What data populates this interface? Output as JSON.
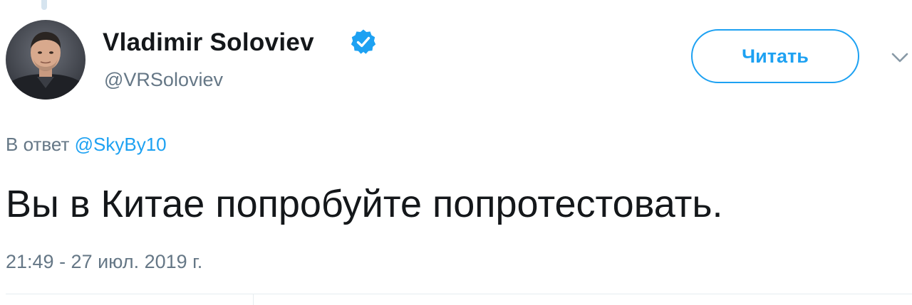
{
  "tweet": {
    "author": {
      "display_name": "Vladimir Soloviev",
      "handle": "@VRSoloviev",
      "verified": true,
      "avatar_icon": "profile-photo"
    },
    "follow_button_label": "Читать",
    "menu_icon": "chevron-down-icon",
    "reply": {
      "prefix": "В ответ",
      "to_handle": "@SkyBy10"
    },
    "text": "Вы в Китае попробуйте попротестовать.",
    "timestamp": "21:49 - 27 июл. 2019 г."
  },
  "colors": {
    "accent": "#1da1f2",
    "text_primary": "#14171a",
    "text_secondary": "#657786",
    "divider": "#e6ecf0"
  }
}
